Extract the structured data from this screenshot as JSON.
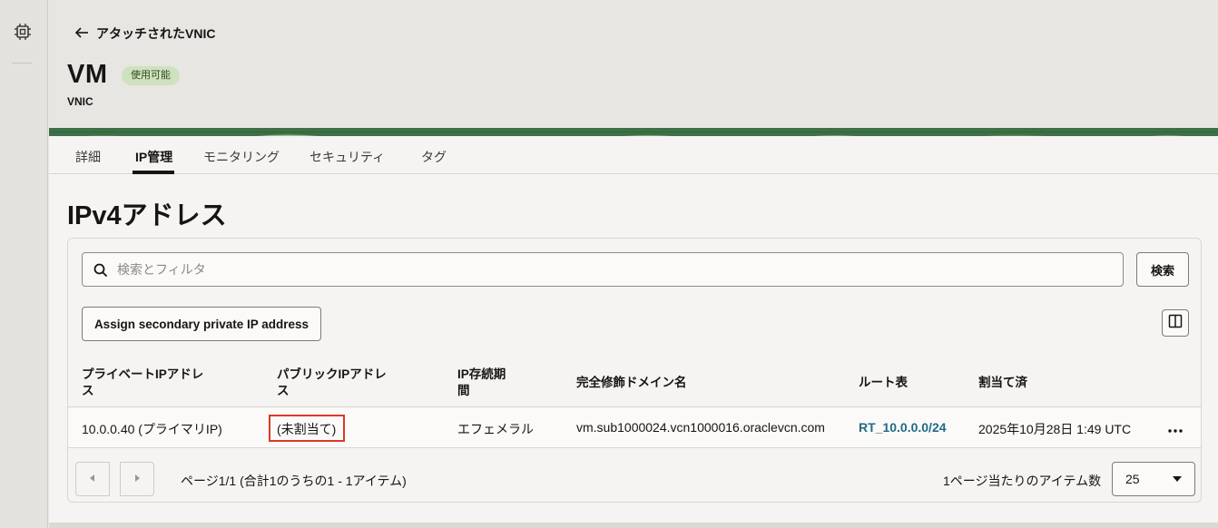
{
  "header": {
    "back_label": "アタッチされたVNIC",
    "title": "VM",
    "status_badge": "使用可能",
    "subtitle": "VNIC"
  },
  "tabs": [
    {
      "label": "詳細",
      "active": false
    },
    {
      "label": "IP管理",
      "active": true
    },
    {
      "label": "モニタリング",
      "active": false
    },
    {
      "label": "セキュリティ",
      "active": false
    },
    {
      "label": "タグ",
      "active": false
    }
  ],
  "section": {
    "title": "IPv4アドレス"
  },
  "search": {
    "placeholder": "検索とフィルタ",
    "value": "",
    "button_label": "検索"
  },
  "toolbar": {
    "assign_label": "Assign secondary private IP address"
  },
  "table": {
    "columns": [
      "プライベートIPアドレス",
      "パブリックIPアドレス",
      "IP存続期間",
      "完全修飾ドメイン名",
      "ルート表",
      "割当て済"
    ],
    "column_lines": [
      [
        "プライベートIPアドレ",
        "ス"
      ],
      [
        "パブリックIPアドレ",
        "ス"
      ],
      [
        "IP存続期",
        "間"
      ],
      [
        "完全修飾ドメイン名"
      ],
      [
        "ルート表"
      ],
      [
        "割当て済"
      ]
    ],
    "rows": [
      {
        "private_ip": "10.0.0.40 (プライマリIP)",
        "public_ip": "(未割当て)",
        "lifetime": "エフェメラル",
        "fqdn": "vm.sub1000024.vcn1000016.oraclevcn.com",
        "route_table": "RT_10.0.0.0/24",
        "assigned": "2025年10月28日 1:49 UTC"
      }
    ]
  },
  "pagination": {
    "summary": "ページ1/1 (合計1のうちの1 - 1アイテム)",
    "per_page_label": "1ページ当たりのアイテム数",
    "per_page_value": "25"
  },
  "colors": {
    "badge_bg": "#cfe1bf",
    "link": "#1f6b86",
    "highlight": "#d93a25"
  }
}
